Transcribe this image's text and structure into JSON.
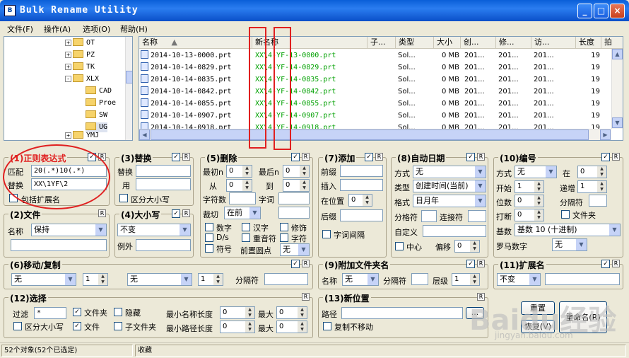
{
  "window": {
    "title": "Bulk Rename Utility",
    "icon": "app-icon",
    "min": "_",
    "max": "□",
    "close": "×"
  },
  "menu": [
    "文件(F)",
    "操作(A)",
    "选项(O)",
    "帮助(H)"
  ],
  "tree": [
    {
      "label": "OT",
      "expander": "+"
    },
    {
      "label": "PZ",
      "expander": "+"
    },
    {
      "label": "TK",
      "expander": "+"
    },
    {
      "label": "XLX",
      "expander": "-"
    },
    {
      "label": "CAD"
    },
    {
      "label": "Proe"
    },
    {
      "label": "SW"
    },
    {
      "label": "UG"
    },
    {
      "label": "YMJ",
      "expander": "+"
    }
  ],
  "list": {
    "headers": [
      "名称",
      "新名称",
      "子...",
      "类型",
      "大小",
      "创...",
      "修...",
      "访...",
      "长度",
      "拍"
    ],
    "sort_arrow": "▲",
    "rows": [
      {
        "name": "2014-10-13-0000.prt",
        "new": "XX\\4-YF-13-0000.prt",
        "sub": "",
        "type": "Sol...",
        "size": "0 MB",
        "c": "201...",
        "m": "201...",
        "a": "201...",
        "len": "19"
      },
      {
        "name": "2014-10-14-0829.prt",
        "new": "XX\\4-YF-14-0829.prt",
        "sub": "",
        "type": "Sol...",
        "size": "0 MB",
        "c": "201...",
        "m": "201...",
        "a": "201...",
        "len": "19"
      },
      {
        "name": "2014-10-14-0835.prt",
        "new": "XX\\4-YF-14-0835.prt",
        "sub": "",
        "type": "Sol...",
        "size": "0 MB",
        "c": "201...",
        "m": "201...",
        "a": "201...",
        "len": "19"
      },
      {
        "name": "2014-10-14-0842.prt",
        "new": "XX\\4-YF-14-0842.prt",
        "sub": "",
        "type": "Sol...",
        "size": "0 MB",
        "c": "201...",
        "m": "201...",
        "a": "201...",
        "len": "19"
      },
      {
        "name": "2014-10-14-0855.prt",
        "new": "XX\\4-YF-14-0855.prt",
        "sub": "",
        "type": "Sol...",
        "size": "0 MB",
        "c": "201...",
        "m": "201...",
        "a": "201...",
        "len": "19"
      },
      {
        "name": "2014-10-14-0907.prt",
        "new": "XX\\4-YF-14-0907.prt",
        "sub": "",
        "type": "Sol...",
        "size": "0 MB",
        "c": "201...",
        "m": "201...",
        "a": "201...",
        "len": "19"
      },
      {
        "name": "2014-10-14-0918.prt",
        "new": "XX\\4-YF-14-0918.prt",
        "sub": "",
        "type": "Sol...",
        "size": "0 MB",
        "c": "201...",
        "m": "201...",
        "a": "201...",
        "len": "19"
      }
    ]
  },
  "p1": {
    "title": "(1)正则表达式",
    "r": "R",
    "check": "✓",
    "match_label": "匹配",
    "match_value": "20(.*)10(.*)",
    "replace_label": "替换",
    "replace_value": "XX\\1YF\\2",
    "ext_label": "包括扩展名"
  },
  "p2": {
    "title": "(2)文件",
    "r": "R",
    "name_label": "名称",
    "name_value": "保持"
  },
  "p3": {
    "title": "(3)替换",
    "r": "R",
    "check": "✓",
    "replace_label": "替换",
    "with_label": "用",
    "case_label": "区分大小写"
  },
  "p4": {
    "title": "(4)大小写",
    "r": "R",
    "check": "✓",
    "value": "不变",
    "except_label": "例外"
  },
  "p5": {
    "title": "(5)删除",
    "r": "R",
    "check": "✓",
    "first_n": "最初n",
    "last_n": "最后n",
    "from": "从",
    "to": "到",
    "chars": "字符数",
    "words": "字词",
    "crop": "裁切",
    "crop_value": "在前",
    "digits": "数字",
    "cjk": "汉字",
    "trim": "修饰",
    "ds": "D/s",
    "accents": "重音符",
    "char": "字符",
    "symbols": "符号",
    "leading_dots": "前置圆点",
    "none": "无",
    "v0": "0"
  },
  "p6": {
    "title": "(6)移动/复制",
    "r": "R",
    "check": "✓",
    "a": "无",
    "b": "1",
    "c": "无",
    "d": "1",
    "sep": "分隔符"
  },
  "p7": {
    "title": "(7)添加",
    "r": "R",
    "check": "✓",
    "prefix": "前缀",
    "insert": "插入",
    "at_pos": "在位置",
    "at_value": "0",
    "suffix": "后缀",
    "word_space": "字词间隔"
  },
  "p8": {
    "title": "(8)自动日期",
    "r": "R",
    "check": "✓",
    "mode_label": "方式",
    "mode": "无",
    "type_label": "类型",
    "type": "创建时间(当前)",
    "fmt_label": "格式",
    "fmt": "日月年",
    "sep_label": "分格符",
    "conn_label": "连接符",
    "custom_label": "自定义",
    "center_label": "中心",
    "offset_label": "偏移",
    "offset": "0"
  },
  "p9": {
    "title": "(9)附加文件夹名",
    "r": "R",
    "check": "✓",
    "name_label": "名称",
    "name": "无",
    "sep": "分隔符",
    "level": "层级",
    "level_val": "1"
  },
  "p10": {
    "title": "(10)编号",
    "r": "R",
    "check": "✓",
    "mode_label": "方式",
    "mode": "无",
    "at_label": "在",
    "at": "0",
    "start_label": "开始",
    "start": "1",
    "inc_label": "递增",
    "inc": "1",
    "pad_label": "位数",
    "pad": "0",
    "sep_label": "分隔符",
    "break_label": "打断",
    "break": "0",
    "folder_label": "文件夹",
    "base_label": "基数",
    "base": "基数 10 (十进制)",
    "roman_label": "罗马数字",
    "roman": "无"
  },
  "p11": {
    "title": "(11)扩展名",
    "r": "R",
    "check": "✓",
    "value": "不变"
  },
  "p12": {
    "title": "(12)选择",
    "r": "R",
    "filter_label": "过滤",
    "filter": "*",
    "folders": "文件夹",
    "hidden": "隐藏",
    "min_name": "最小名称长度",
    "max": "最大",
    "case": "区分大小写",
    "files": "文件",
    "subfolders": "子文件夹",
    "min_path": "最小路径长度",
    "v0": "0"
  },
  "p13": {
    "title": "(13)新位置",
    "r": "R",
    "path_label": "路径",
    "browse": "...",
    "copy_label": "复制不移动"
  },
  "buttons": {
    "reset": "重置",
    "undo": "恢复(V)",
    "rename": "重命名(R)"
  },
  "status": {
    "count": "52个对象(52个已选定)",
    "fav": "收藏"
  },
  "watermark": {
    "big": "Baidu经验",
    "small": "jingyan.baidu.com"
  }
}
